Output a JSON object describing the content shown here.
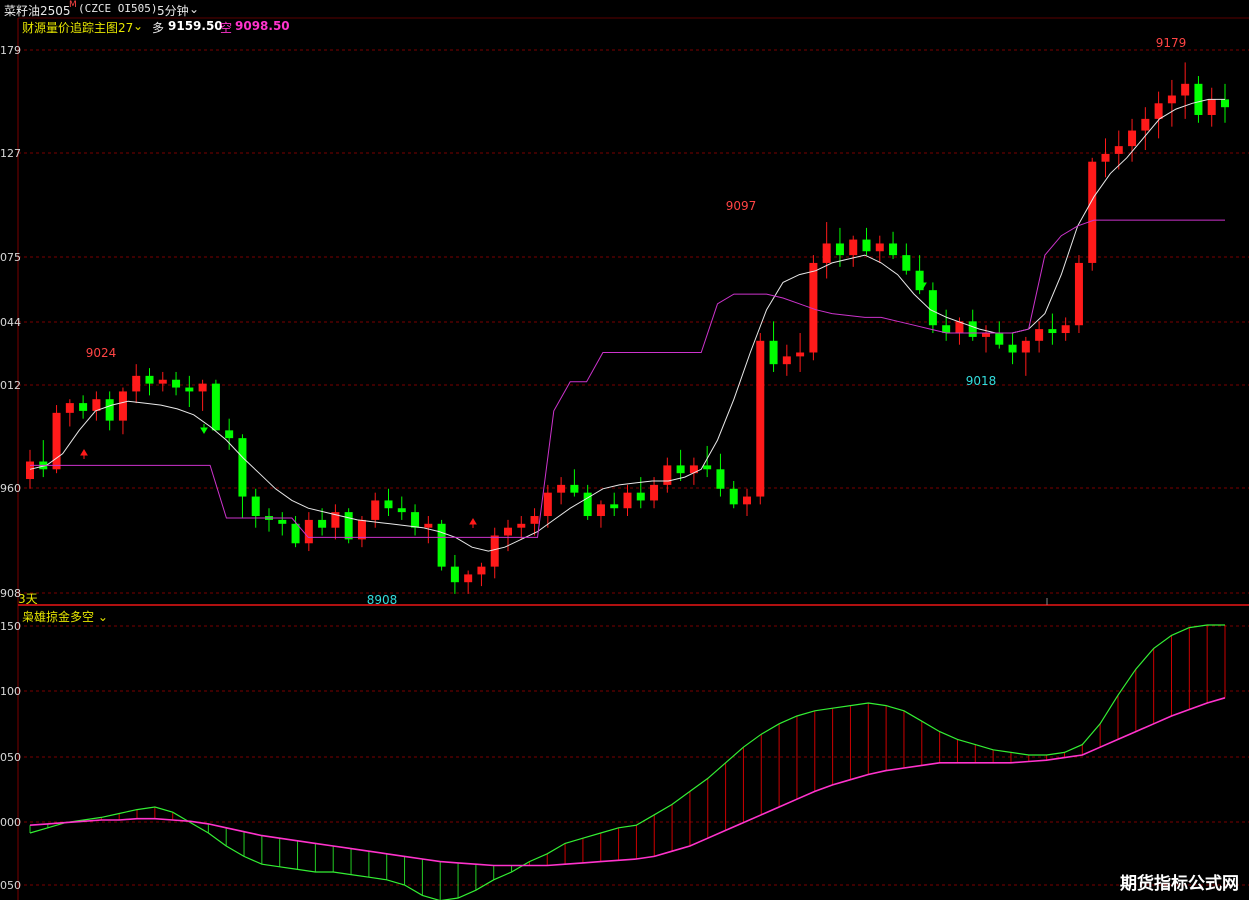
{
  "header": {
    "symbol_name": "菜籽油2505",
    "symbol_flag": "M",
    "symbol_code": "(CZCE OI505)",
    "period": "5分钟",
    "period_chevron_icon": "chevron-down-icon"
  },
  "main_panel": {
    "indicator_name": "财源量价追踪主图27",
    "indicator_chevron_icon": "chevron-down-icon",
    "long_label": "多",
    "long_value": "9159.50",
    "short_label": "空",
    "short_value": "9098.50",
    "days_label": "3天",
    "high_label": "9179",
    "low_label": "8908",
    "peak_labels": [
      "9024",
      "9097",
      "9018"
    ]
  },
  "sub_panel": {
    "indicator_name": "枭雄掠金多空",
    "indicator_chevron_icon": "chevron-down-icon"
  },
  "watermark": "期货指标公式网",
  "colors": {
    "background": "#000000",
    "up": "#ff1a1a",
    "down": "#00ff00",
    "line_white": "#e8e8e8",
    "line_magenta": "#cc33cc",
    "grid": "#7a0000",
    "hist_up": "#cc0000",
    "hist_down": "#22cc22",
    "slow_line": "#ff33cc",
    "label_red": "#ff4444",
    "label_cyan": "#33dddd",
    "yellow": "#e6e600"
  },
  "chart_data": {
    "type": "candlestick",
    "y_ticks_main": [
      "179",
      "127",
      "075",
      "044",
      "012",
      "960",
      "908"
    ],
    "y_ticks_sub": [
      "150",
      "100",
      "050",
      "000",
      "050"
    ],
    "ylim_main": [
      8908,
      9190
    ],
    "candles": [
      [
        8965,
        8980,
        8960,
        8974
      ],
      [
        8974,
        8985,
        8966,
        8970
      ],
      [
        8970,
        9003,
        8968,
        8999
      ],
      [
        8999,
        9006,
        8992,
        9004
      ],
      [
        9004,
        9008,
        8996,
        9000
      ],
      [
        9000,
        9010,
        8995,
        9006
      ],
      [
        9006,
        9010,
        8990,
        8995
      ],
      [
        8995,
        9012,
        8988,
        9010
      ],
      [
        9010,
        9024,
        9004,
        9018
      ],
      [
        9018,
        9022,
        9008,
        9014
      ],
      [
        9014,
        9020,
        9010,
        9016
      ],
      [
        9016,
        9020,
        9008,
        9012
      ],
      [
        9012,
        9018,
        9002,
        9010
      ],
      [
        9010,
        9016,
        9000,
        9014
      ],
      [
        9014,
        9016,
        8990,
        8990
      ],
      [
        8990,
        8996,
        8980,
        8986
      ],
      [
        8986,
        8988,
        8945,
        8956
      ],
      [
        8956,
        8960,
        8940,
        8946
      ],
      [
        8946,
        8950,
        8938,
        8944
      ],
      [
        8944,
        8948,
        8936,
        8942
      ],
      [
        8942,
        8946,
        8930,
        8932
      ],
      [
        8932,
        8948,
        8928,
        8944
      ],
      [
        8944,
        8950,
        8936,
        8940
      ],
      [
        8940,
        8952,
        8934,
        8948
      ],
      [
        8948,
        8950,
        8932,
        8934
      ],
      [
        8934,
        8946,
        8930,
        8944
      ],
      [
        8944,
        8958,
        8940,
        8954
      ],
      [
        8954,
        8960,
        8946,
        8950
      ],
      [
        8950,
        8956,
        8944,
        8948
      ],
      [
        8948,
        8952,
        8936,
        8940
      ],
      [
        8940,
        8946,
        8932,
        8942
      ],
      [
        8942,
        8944,
        8918,
        8920
      ],
      [
        8920,
        8926,
        8906,
        8912
      ],
      [
        8912,
        8918,
        8906,
        8916
      ],
      [
        8916,
        8922,
        8910,
        8920
      ],
      [
        8920,
        8940,
        8914,
        8936
      ],
      [
        8936,
        8944,
        8928,
        8940
      ],
      [
        8940,
        8946,
        8934,
        8942
      ],
      [
        8942,
        8950,
        8936,
        8946
      ],
      [
        8946,
        8962,
        8940,
        8958
      ],
      [
        8958,
        8966,
        8952,
        8962
      ],
      [
        8962,
        8970,
        8956,
        8958
      ],
      [
        8958,
        8962,
        8944,
        8946
      ],
      [
        8946,
        8954,
        8940,
        8952
      ],
      [
        8952,
        8958,
        8946,
        8950
      ],
      [
        8950,
        8962,
        8946,
        8958
      ],
      [
        8958,
        8966,
        8950,
        8954
      ],
      [
        8954,
        8966,
        8950,
        8962
      ],
      [
        8962,
        8976,
        8958,
        8972
      ],
      [
        8972,
        8980,
        8964,
        8968
      ],
      [
        8968,
        8976,
        8962,
        8972
      ],
      [
        8972,
        8982,
        8966,
        8970
      ],
      [
        8970,
        8978,
        8956,
        8960
      ],
      [
        8960,
        8964,
        8950,
        8952
      ],
      [
        8952,
        8960,
        8946,
        8956
      ],
      [
        8956,
        9040,
        8952,
        9036
      ],
      [
        9036,
        9046,
        9020,
        9024
      ],
      [
        9024,
        9034,
        9018,
        9028
      ],
      [
        9028,
        9040,
        9020,
        9030
      ],
      [
        9030,
        9080,
        9026,
        9076
      ],
      [
        9076,
        9097,
        9068,
        9086
      ],
      [
        9086,
        9094,
        9074,
        9080
      ],
      [
        9080,
        9090,
        9074,
        9088
      ],
      [
        9088,
        9094,
        9080,
        9082
      ],
      [
        9082,
        9090,
        9076,
        9086
      ],
      [
        9086,
        9092,
        9078,
        9080
      ],
      [
        9080,
        9086,
        9070,
        9072
      ],
      [
        9072,
        9080,
        9060,
        9062
      ],
      [
        9062,
        9066,
        9040,
        9044
      ],
      [
        9044,
        9052,
        9036,
        9040
      ],
      [
        9040,
        9048,
        9034,
        9046
      ],
      [
        9046,
        9052,
        9036,
        9038
      ],
      [
        9038,
        9044,
        9030,
        9040
      ],
      [
        9040,
        9046,
        9032,
        9034
      ],
      [
        9034,
        9040,
        9024,
        9030
      ],
      [
        9030,
        9038,
        9018,
        9036
      ],
      [
        9036,
        9046,
        9030,
        9042
      ],
      [
        9042,
        9050,
        9034,
        9040
      ],
      [
        9040,
        9048,
        9036,
        9044
      ],
      [
        9044,
        9080,
        9040,
        9076
      ],
      [
        9076,
        9130,
        9072,
        9128
      ],
      [
        9128,
        9140,
        9120,
        9132
      ],
      [
        9132,
        9144,
        9124,
        9136
      ],
      [
        9136,
        9150,
        9128,
        9144
      ],
      [
        9144,
        9156,
        9134,
        9150
      ],
      [
        9150,
        9164,
        9140,
        9158
      ],
      [
        9158,
        9170,
        9146,
        9162
      ],
      [
        9162,
        9179,
        9150,
        9168
      ],
      [
        9168,
        9172,
        9148,
        9152
      ],
      [
        9152,
        9166,
        9146,
        9160
      ],
      [
        9160,
        9168,
        9148,
        9156
      ]
    ],
    "white_line": [
      8970,
      8972,
      8978,
      8990,
      9000,
      9003,
      9005,
      9004,
      9003,
      9001,
      8998,
      8992,
      8985,
      8976,
      8968,
      8960,
      8954,
      8950,
      8948,
      8946,
      8944,
      8943,
      8942,
      8941,
      8940,
      8938,
      8935,
      8930,
      8928,
      8930,
      8934,
      8938,
      8944,
      8950,
      8955,
      8960,
      8962,
      8963,
      8964,
      8964,
      8966,
      8970,
      8985,
      9006,
      9030,
      9052,
      9066,
      9070,
      9072,
      9076,
      9078,
      9080,
      9076,
      9070,
      9060,
      9052,
      9048,
      9045,
      9042,
      9040,
      9040,
      9042,
      9050,
      9070,
      9095,
      9110,
      9122,
      9130,
      9140,
      9150,
      9155,
      9158,
      9160,
      9160
    ],
    "magenta_line": [
      8972,
      8972,
      8972,
      8972,
      8972,
      8972,
      8972,
      8972,
      8972,
      8972,
      8972,
      8972,
      8945,
      8945,
      8945,
      8945,
      8945,
      8935,
      8935,
      8935,
      8935,
      8935,
      8935,
      8935,
      8935,
      8935,
      8935,
      8935,
      8935,
      8935,
      8935,
      8935,
      9000,
      9015,
      9015,
      9030,
      9030,
      9030,
      9030,
      9030,
      9030,
      9030,
      9055,
      9060,
      9060,
      9060,
      9058,
      9055,
      9052,
      9050,
      9049,
      9048,
      9048,
      9046,
      9044,
      9042,
      9040,
      9040,
      9040,
      9040,
      9040,
      9042,
      9080,
      9090,
      9095,
      9098,
      9098,
      9098,
      9098,
      9098,
      9098,
      9098,
      9098,
      9098
    ],
    "sub_hist": [
      -10,
      -6,
      -2,
      0,
      2,
      5,
      8,
      10,
      6,
      -2,
      -10,
      -20,
      -28,
      -34,
      -36,
      -38,
      -40,
      -40,
      -42,
      -44,
      -46,
      -50,
      -58,
      -62,
      -60,
      -54,
      -46,
      -40,
      -32,
      -26,
      -18,
      -14,
      -10,
      -6,
      -4,
      4,
      12,
      22,
      32,
      44,
      56,
      66,
      74,
      80,
      84,
      86,
      88,
      90,
      88,
      84,
      76,
      68,
      62,
      58,
      54,
      52,
      50,
      50,
      52,
      58,
      74,
      96,
      116,
      132,
      142,
      148,
      150,
      150
    ],
    "sub_slow": [
      -4,
      -3,
      -2,
      -1,
      0,
      0,
      1,
      1,
      0,
      -1,
      -3,
      -6,
      -9,
      -12,
      -14,
      -16,
      -18,
      -20,
      -22,
      -24,
      -26,
      -28,
      -30,
      -32,
      -33,
      -34,
      -35,
      -35,
      -35,
      -35,
      -34,
      -33,
      -32,
      -31,
      -30,
      -28,
      -24,
      -20,
      -14,
      -8,
      -2,
      4,
      10,
      16,
      22,
      27,
      31,
      35,
      38,
      40,
      42,
      44,
      44,
      44,
      44,
      44,
      45,
      46,
      48,
      50,
      56,
      62,
      68,
      74,
      80,
      85,
      90,
      94
    ]
  }
}
